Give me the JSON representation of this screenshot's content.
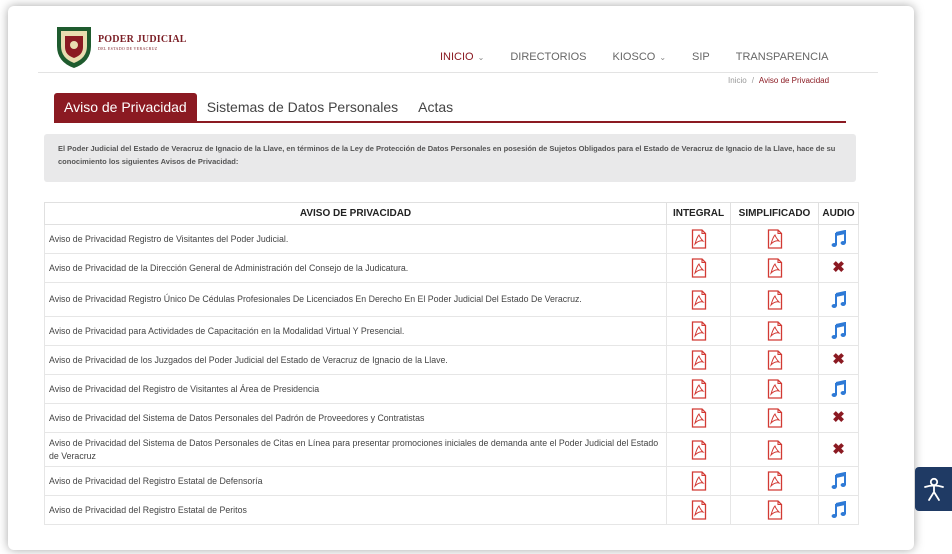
{
  "brand": {
    "title": "PODER JUDICIAL",
    "subtitle": "DEL ESTADO DE VERACRUZ"
  },
  "nav": [
    {
      "label": "INICIO",
      "caret": "⌄",
      "active": true
    },
    {
      "label": "DIRECTORIOS",
      "caret": "",
      "active": false
    },
    {
      "label": "KIOSCO",
      "caret": "⌄",
      "active": false
    },
    {
      "label": "SIP",
      "caret": "",
      "active": false
    },
    {
      "label": "TRANSPARENCIA",
      "caret": "",
      "active": false
    }
  ],
  "breadcrumb": {
    "home": "Inicio",
    "separator": "/",
    "current": "Aviso de Privacidad"
  },
  "tabs": [
    {
      "label": "Aviso de Privacidad",
      "active": true
    },
    {
      "label": "Sistemas de Datos Personales",
      "active": false
    },
    {
      "label": "Actas",
      "active": false
    }
  ],
  "intro": "El Poder Judicial del Estado de Veracruz de Ignacio de la Llave, en términos de la Ley de Protección de Datos Personales en posesión de Sujetos Obligados para el Estado de Veracruz de Ignacio de la Llave, hace de su conocimiento los siguientes Avisos de Privacidad:",
  "table": {
    "headers": {
      "aviso": "AVISO DE PRIVACIDAD",
      "integral": "INTEGRAL",
      "simplificado": "SIMPLIFICADO",
      "audio": "AUDIO"
    },
    "rows": [
      {
        "title": "Aviso de Privacidad Registro de Visitantes del Poder Judicial.",
        "audio": true
      },
      {
        "title": "Aviso de Privacidad de la Dirección General de Administración del Consejo de la Judicatura.",
        "audio": false
      },
      {
        "title": "Aviso de Privacidad Registro Único De Cédulas Profesionales De Licenciados En Derecho En El Poder Judicial Del Estado De Veracruz.",
        "audio": true
      },
      {
        "title": "Aviso de Privacidad para Actividades de Capacitación en la Modalidad Virtual Y Presencial.",
        "audio": true
      },
      {
        "title": "Aviso de Privacidad de los Juzgados del Poder Judicial del Estado de Veracruz de Ignacio de la Llave.",
        "audio": false
      },
      {
        "title": "Aviso de Privacidad del Registro de Visitantes al Área de Presidencia",
        "audio": true
      },
      {
        "title": "Aviso de Privacidad del Sistema de Datos Personales del Padrón de Proveedores y Contratistas",
        "audio": false
      },
      {
        "title": "Aviso de Privacidad del Sistema de Datos Personales de Citas en Línea para presentar promociones iniciales de demanda ante el Poder Judicial del Estado de Veracruz",
        "audio": false
      },
      {
        "title": "Aviso de Privacidad del Registro Estatal de Defensoría",
        "audio": true
      },
      {
        "title": "Aviso de Privacidad del Registro Estatal de Peritos",
        "audio": true
      }
    ]
  },
  "colors": {
    "brand": "#8b1a22",
    "audio": "#2f7ad6",
    "accessibility": "#1f3a64"
  },
  "icons": {
    "pdf": "pdf-icon",
    "audio": "music-note-icon",
    "unavailable": "close-icon",
    "accessibility": "accessibility-icon"
  }
}
